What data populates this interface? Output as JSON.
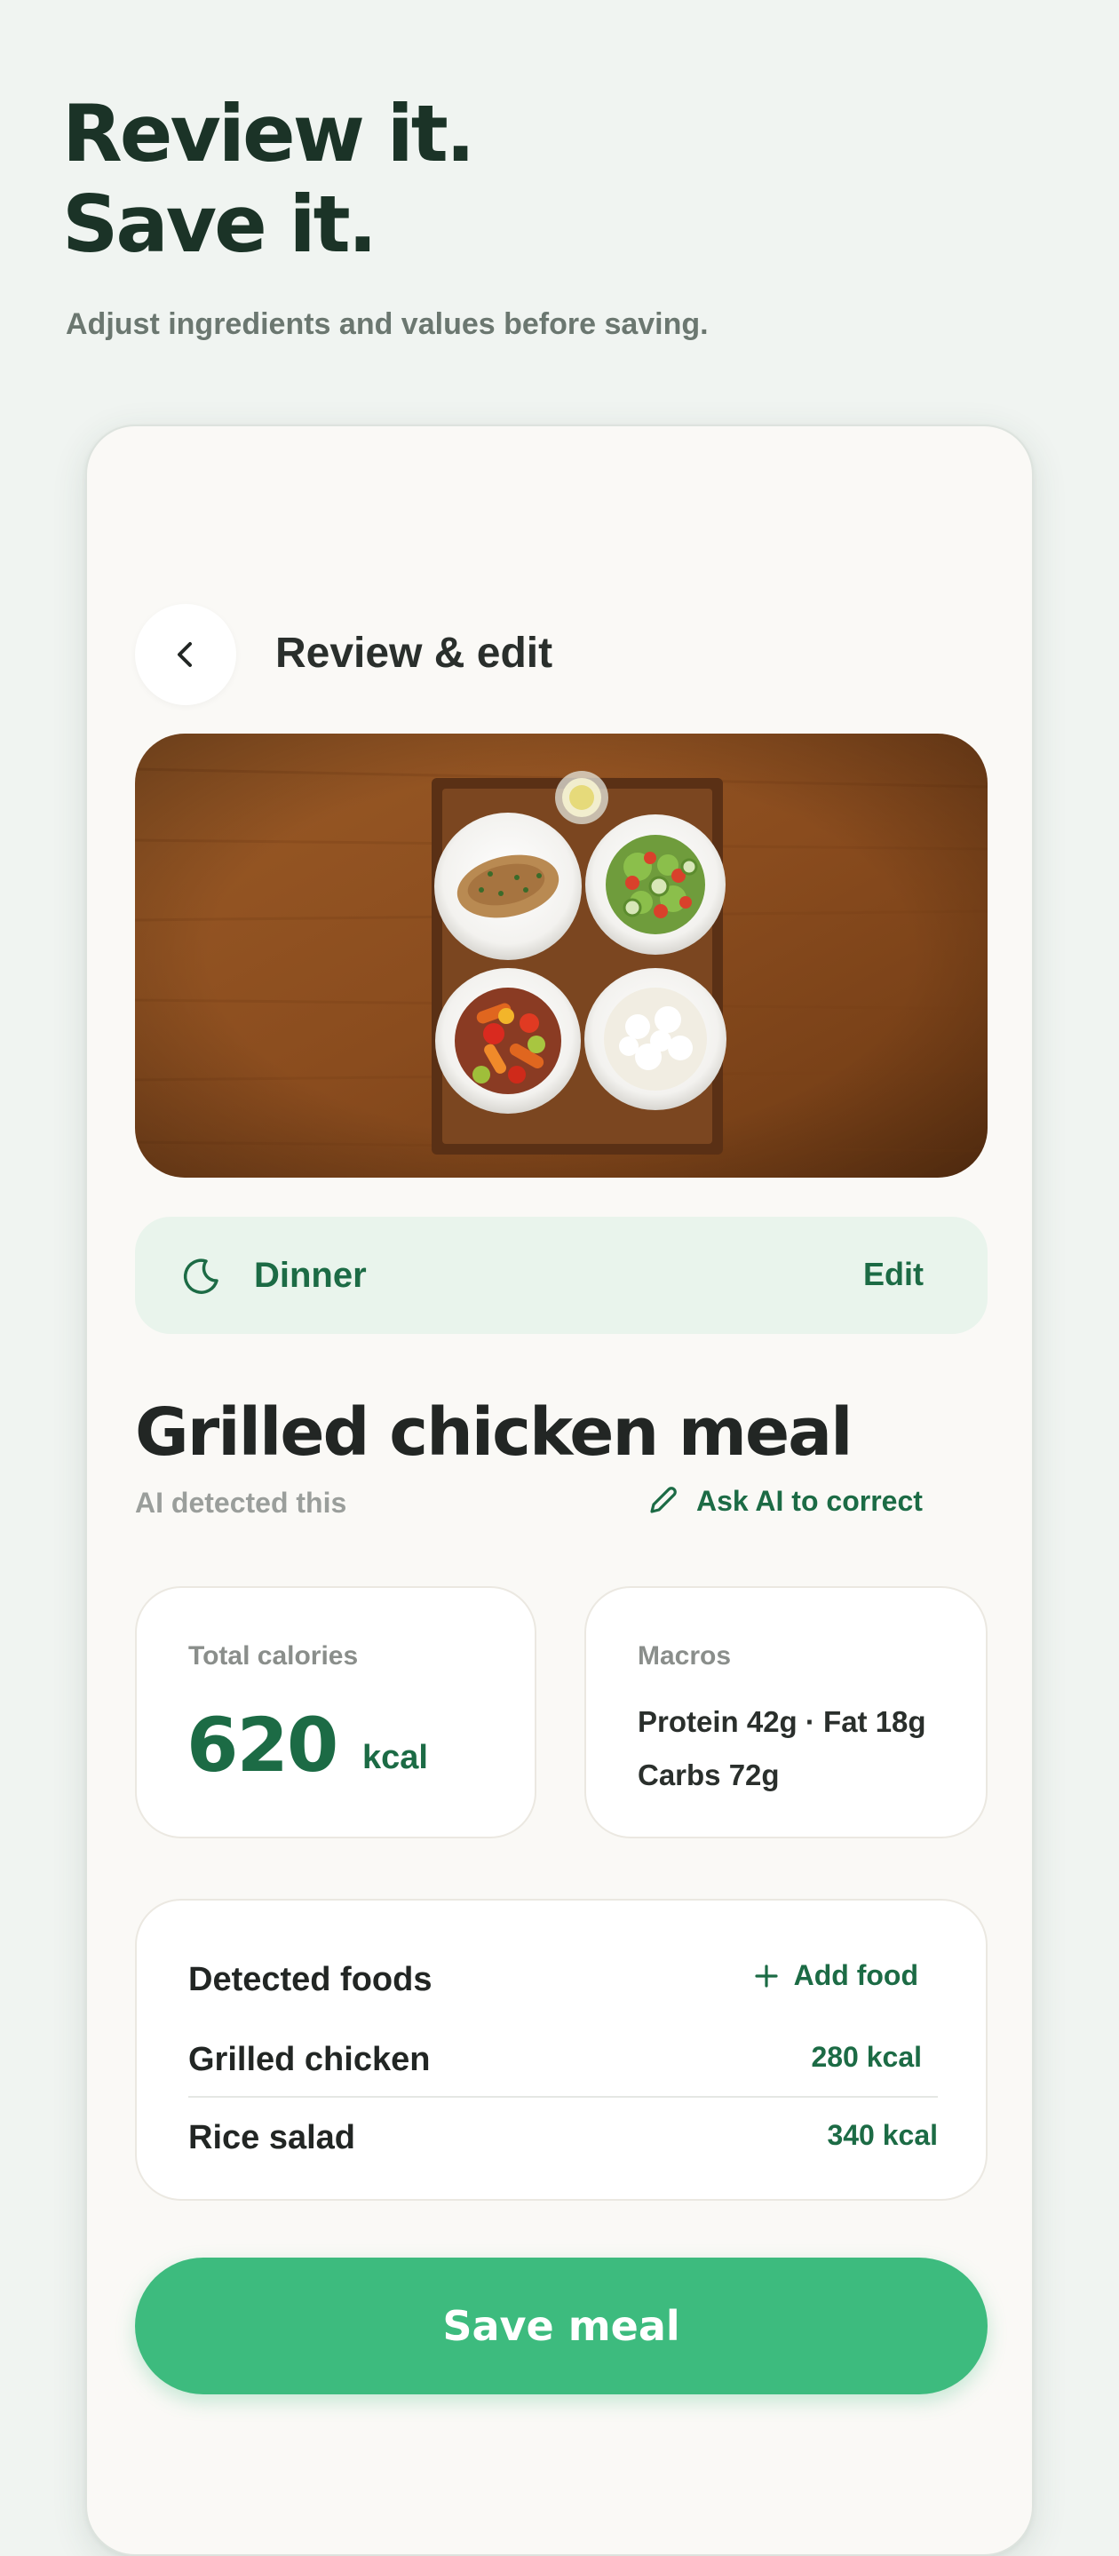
{
  "hero": {
    "title_line1": "Review it.",
    "title_line2": "Save it.",
    "subtitle": "Adjust ingredients and values before saving."
  },
  "header": {
    "back_icon": "chevron-left-icon",
    "title": "Review & edit"
  },
  "photo": {
    "subject": "meal-photo"
  },
  "meal_type": {
    "icon": "moon-icon",
    "label": "Dinner",
    "edit_label": "Edit"
  },
  "meal": {
    "title": "Grilled chicken meal",
    "ai_note": "AI detected this",
    "ask_ai_icon": "pencil-icon",
    "ask_ai_label": "Ask AI to correct"
  },
  "calories": {
    "label": "Total calories",
    "value": "620",
    "unit": "kcal"
  },
  "macros": {
    "label": "Macros",
    "line1": "Protein 42g · Fat 18g",
    "line2": "Carbs 72g"
  },
  "foods": {
    "heading": "Detected foods",
    "add_icon": "plus-icon",
    "add_label": "Add food",
    "items": [
      {
        "name": "Grilled chicken",
        "kcal": "280 kcal"
      },
      {
        "name": "Rice salad",
        "kcal": "340 kcal"
      }
    ]
  },
  "actions": {
    "save_label": "Save meal"
  },
  "colors": {
    "brand_green": "#3dbb7e",
    "dark_green": "#1c6b45",
    "pill_bg": "#e9f4ec",
    "page_bg": "#f0f4f1"
  }
}
